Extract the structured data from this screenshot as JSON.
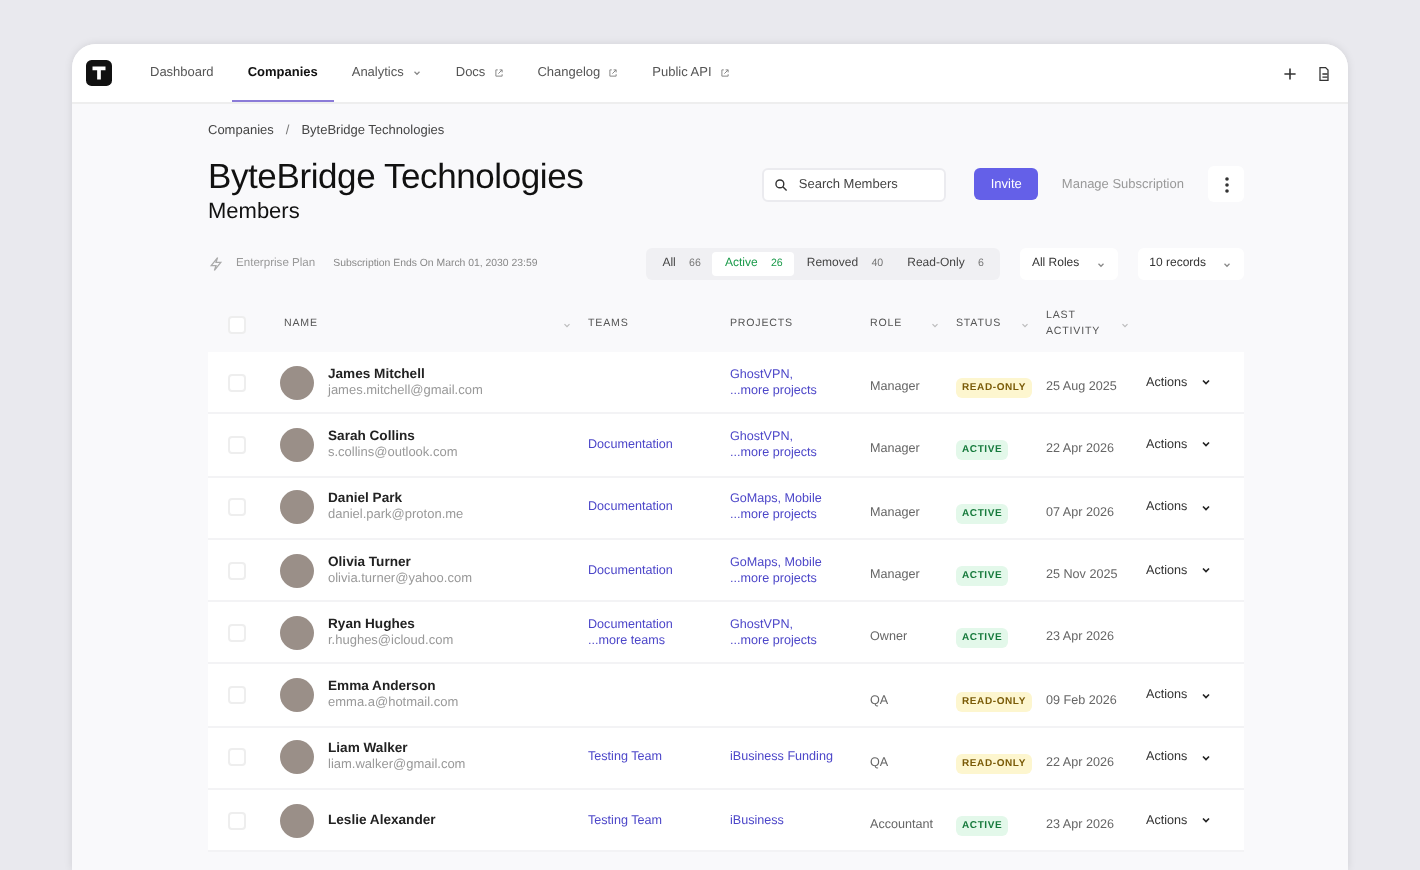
{
  "nav": {
    "tabs": [
      {
        "label": "Dashboard",
        "kind": "plain",
        "selected": false
      },
      {
        "label": "Companies",
        "kind": "plain",
        "selected": true
      },
      {
        "label": "Analytics",
        "kind": "dropdown",
        "selected": false
      },
      {
        "label": "Docs",
        "kind": "external",
        "selected": false
      },
      {
        "label": "Changelog",
        "kind": "external",
        "selected": false
      },
      {
        "label": "Public API",
        "kind": "external",
        "selected": false
      }
    ]
  },
  "breadcrumb": [
    "Companies",
    "/",
    "ByteBridge Technologies"
  ],
  "title": "ByteBridge Technologies",
  "subtitle": "Members",
  "search": {
    "placeholder": "Search Members"
  },
  "invite_button": "Invite",
  "manage_button": "Manage Subscription",
  "plan": "Enterprise Plan",
  "subscription": "Subscription Ends On March 01, 2030 23:59",
  "filters": [
    {
      "label": "All",
      "count": "66",
      "selected": false
    },
    {
      "label": "Active",
      "count": "26",
      "selected": true
    },
    {
      "label": "Removed",
      "count": "40",
      "selected": false
    },
    {
      "label": "Read-Only",
      "count": "6",
      "selected": false
    }
  ],
  "role_select": "All Roles",
  "records_select": "10 records",
  "table": {
    "select_all_checked": false,
    "columns": [
      {
        "label": "NAME",
        "sortable": true
      },
      {
        "label": "TEAMS",
        "sortable": false
      },
      {
        "label": "PROJECTS",
        "sortable": false
      },
      {
        "label": "ROLE",
        "sortable": true
      },
      {
        "label": "STATUS",
        "sortable": true
      },
      {
        "label": "LAST ACTIVITY",
        "sortable": true
      }
    ],
    "rows": [
      {
        "checked": false,
        "name": "James Mitchell",
        "email": "james.mitchell@gmail.com",
        "teams": [],
        "projects": [
          "GhostVPN,",
          "...more projects"
        ],
        "role": "Manager",
        "status": {
          "label": "READ-ONLY",
          "kind": "read_only"
        },
        "date": "25 Aug 2025",
        "actions": "Actions"
      },
      {
        "checked": false,
        "name": "Sarah Collins",
        "email": "s.collins@outlook.com",
        "teams": [
          "Documentation"
        ],
        "projects": [
          "GhostVPN,",
          "...more projects"
        ],
        "role": "Manager",
        "status": {
          "label": "ACTIVE",
          "kind": "active"
        },
        "date": "22 Apr 2026",
        "actions": "Actions"
      },
      {
        "checked": false,
        "name": "Daniel Park",
        "email": "daniel.park@proton.me",
        "teams": [
          "Documentation"
        ],
        "projects": [
          "GoMaps, Mobile",
          "...more projects"
        ],
        "role": "Manager",
        "status": {
          "label": "ACTIVE",
          "kind": "active"
        },
        "date": "07 Apr 2026",
        "actions": "Actions"
      },
      {
        "checked": false,
        "name": "Olivia Turner",
        "email": "olivia.turner@yahoo.com",
        "teams": [
          "Documentation"
        ],
        "projects": [
          "GoMaps, Mobile",
          "...more projects"
        ],
        "role": "Manager",
        "status": {
          "label": "ACTIVE",
          "kind": "active"
        },
        "date": "25 Nov 2025",
        "actions": "Actions"
      },
      {
        "checked": false,
        "name": "Ryan Hughes",
        "email": "r.hughes@icloud.com",
        "teams": [
          "Documentation",
          "...more teams"
        ],
        "projects": [
          "GhostVPN,",
          "...more projects"
        ],
        "role": "Owner",
        "status": {
          "label": "ACTIVE",
          "kind": "active"
        },
        "date": "23 Apr 2026"
      },
      {
        "checked": false,
        "name": "Emma Anderson",
        "email": "emma.a@hotmail.com",
        "teams": [],
        "projects": [],
        "role": "QA",
        "status": {
          "label": "READ-ONLY",
          "kind": "read_only"
        },
        "date": "09 Feb 2026",
        "actions": "Actions"
      },
      {
        "checked": false,
        "name": "Liam Walker",
        "email": "liam.walker@gmail.com",
        "teams": [
          "Testing Team"
        ],
        "projects": [
          "iBusiness Funding"
        ],
        "role": "QA",
        "status": {
          "label": "READ-ONLY",
          "kind": "read_only"
        },
        "date": "22 Apr 2026",
        "actions": "Actions"
      },
      {
        "checked": false,
        "name": "Leslie Alexander",
        "teams": [
          "Testing Team"
        ],
        "projects": [
          "iBusiness"
        ],
        "role": "Accountant",
        "status": {
          "label": "ACTIVE",
          "kind": "active"
        },
        "date": "23 Apr 2026",
        "actions": "Actions"
      }
    ]
  }
}
